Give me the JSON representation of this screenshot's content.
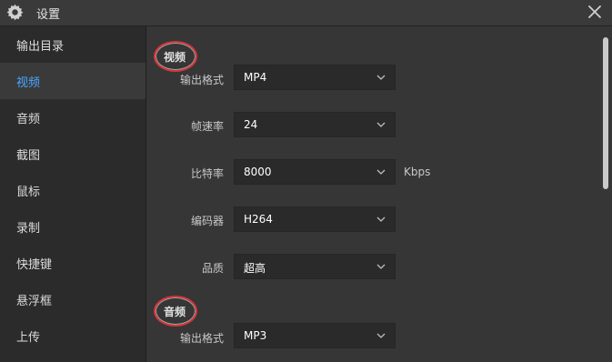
{
  "window": {
    "title": "设置",
    "icons": {
      "app": "gear-icon",
      "close": "close-icon"
    }
  },
  "sidebar": {
    "items": [
      {
        "label": "输出目录"
      },
      {
        "label": "视频",
        "active": true
      },
      {
        "label": "音频"
      },
      {
        "label": "截图"
      },
      {
        "label": "鼠标"
      },
      {
        "label": "录制"
      },
      {
        "label": "快捷键"
      },
      {
        "label": "悬浮框"
      },
      {
        "label": "上传"
      }
    ]
  },
  "video": {
    "title": "视频",
    "format": {
      "label": "输出格式",
      "value": "MP4"
    },
    "framerate": {
      "label": "帧速率",
      "value": "24"
    },
    "bitrate": {
      "label": "比特率",
      "value": "8000",
      "unit": "Kbps"
    },
    "encoder": {
      "label": "编码器",
      "value": "H264"
    },
    "quality": {
      "label": "品质",
      "value": "超高"
    }
  },
  "audio": {
    "title": "音频",
    "format": {
      "label": "输出格式",
      "value": "MP3"
    }
  },
  "colors": {
    "accent": "#4aa8ff",
    "highlight_circle": "#d6353a"
  }
}
